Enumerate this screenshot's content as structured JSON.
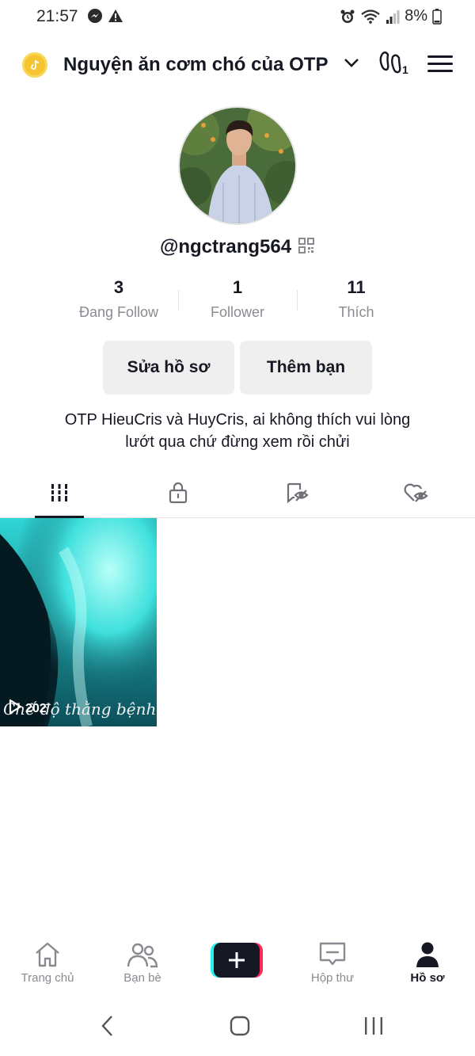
{
  "status_bar": {
    "time": "21:57",
    "battery": "8%",
    "icons": [
      "messenger-icon",
      "warning-icon",
      "alarm-icon",
      "wifi-icon",
      "signal-icon",
      "battery-icon"
    ]
  },
  "header": {
    "title": "Nguyện ăn cơm chó của OTP",
    "footprint_count": "1",
    "icons": [
      "tiktok-coin-icon",
      "chevron-down-icon",
      "footprint-icon",
      "menu-icon"
    ]
  },
  "profile": {
    "username": "@ngctrang564",
    "stats": [
      {
        "value": "3",
        "label": "Đang Follow"
      },
      {
        "value": "1",
        "label": "Follower"
      },
      {
        "value": "11",
        "label": "Thích"
      }
    ],
    "edit_button": "Sửa hồ sơ",
    "add_friend_button": "Thêm bạn",
    "bio_line1": "OTP HieuCris và HuyCris, ai không thích vui lòng",
    "bio_line2": "lướt qua chứ đừng xem rồi chửi"
  },
  "tabs": [
    "videos-grid-icon",
    "private-lock-icon",
    "reposts-eye-icon",
    "liked-heart-icon"
  ],
  "videos": [
    {
      "caption": "Chế độ thằng bệnh hoạn",
      "views": "202"
    }
  ],
  "bottom_nav": [
    {
      "label": "Trang chủ",
      "icon": "home-icon"
    },
    {
      "label": "Bạn bè",
      "icon": "friends-icon"
    },
    {
      "label": "",
      "icon": "create-plus-icon"
    },
    {
      "label": "Hộp thư",
      "icon": "inbox-icon"
    },
    {
      "label": "Hồ sơ",
      "icon": "profile-icon",
      "active": true
    }
  ],
  "colors": {
    "text": "#161823",
    "muted": "#8a8b91",
    "button_bg": "#efefef",
    "coin": "#f6c430",
    "brand_cyan": "#25f4ee",
    "brand_red": "#fe2c55"
  }
}
